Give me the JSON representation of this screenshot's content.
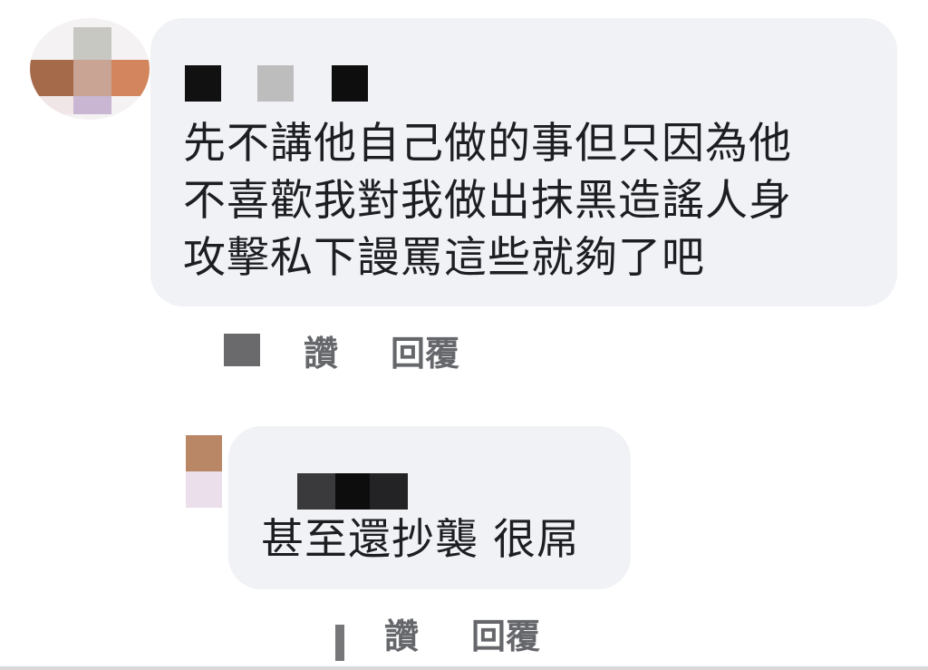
{
  "comments": [
    {
      "author": "[redacted]",
      "text": "先不講他自己做的事但只因為他\n不喜歡我對我做出抹黑造謠人身\n攻擊私下謾罵這些就夠了吧",
      "timestamp": "[redacted]",
      "like_label": "讚",
      "reply_label": "回覆"
    },
    {
      "author": "[redacted]",
      "text": "甚至還抄襲 很屌",
      "timestamp": "[redacted]",
      "like_label": "讚",
      "reply_label": "回覆"
    }
  ],
  "colors": {
    "bubble_background": "#f0f2f5",
    "text": "#1c1e21",
    "action_text": "#65676b"
  },
  "icons": {
    "avatar_1": "pixelated-avatar",
    "avatar_2": "pixelated-avatar"
  }
}
